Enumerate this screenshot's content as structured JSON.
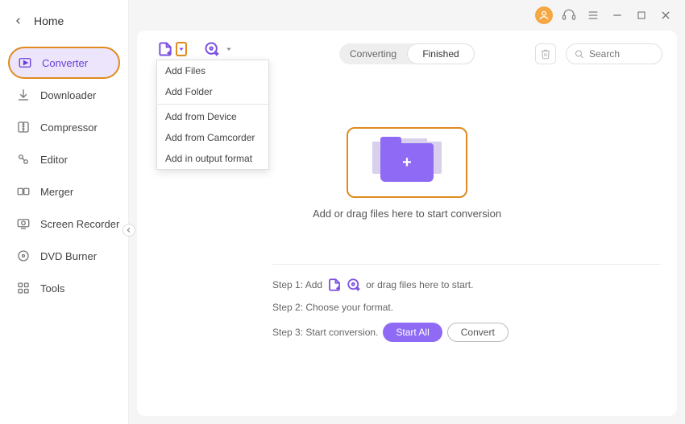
{
  "titlebar": {
    "avatar": "avatar",
    "support": "support",
    "menu": "menu"
  },
  "sidebar": {
    "home_label": "Home",
    "items": [
      {
        "label": "Converter",
        "icon": "converter"
      },
      {
        "label": "Downloader",
        "icon": "downloader"
      },
      {
        "label": "Compressor",
        "icon": "compressor"
      },
      {
        "label": "Editor",
        "icon": "editor"
      },
      {
        "label": "Merger",
        "icon": "merger"
      },
      {
        "label": "Screen Recorder",
        "icon": "screen-recorder"
      },
      {
        "label": "DVD Burner",
        "icon": "dvd-burner"
      },
      {
        "label": "Tools",
        "icon": "tools"
      }
    ]
  },
  "toolbar": {
    "add_file": "add-file",
    "add_dvd": "add-dvd"
  },
  "dropdown": {
    "items": [
      "Add Files",
      "Add Folder",
      "Add from Device",
      "Add from Camcorder",
      "Add in output format"
    ]
  },
  "segment": {
    "converting": "Converting",
    "finished": "Finished"
  },
  "search": {
    "placeholder": "Search"
  },
  "dropzone": {
    "label": "Add or drag files here to start conversion"
  },
  "steps": {
    "s1a": "Step 1: Add",
    "s1b": "or drag files here to start.",
    "s2": "Step 2: Choose your format.",
    "s3": "Step 3: Start conversion.",
    "start_all": "Start All",
    "convert": "Convert"
  },
  "colors": {
    "accent": "#8f6bf5",
    "highlight": "#e08a1f"
  }
}
